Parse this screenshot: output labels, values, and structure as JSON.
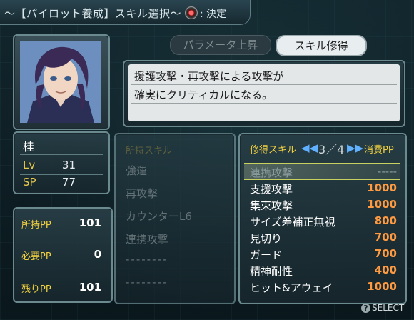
{
  "header": {
    "title": "〜【パイロット養成】スキル選択〜",
    "decide_label": ": 決定"
  },
  "pilot": {
    "name": "桂",
    "lv_label": "Lv",
    "lv": "31",
    "sp_label": "SP",
    "sp": "77"
  },
  "pp": {
    "owned_label": "所持PP",
    "owned": "101",
    "required_label": "必要PP",
    "required": "0",
    "remaining_label": "残りPP",
    "remaining": "101"
  },
  "tabs": {
    "param_label": "パラメータ上昇",
    "skill_label": "スキル修得"
  },
  "description": {
    "line1": "援護攻撃・再攻撃による攻撃が",
    "line2": "確実にクリティカルになる。"
  },
  "owned_skills": {
    "title": "所持スキル",
    "items": [
      "強運",
      "再攻撃",
      "カウンターL6",
      "連携攻撃",
      "--------",
      "--------"
    ]
  },
  "learn": {
    "title": "修得スキル",
    "page": "3／4",
    "cost_title": "消費PP",
    "items": [
      {
        "name": "連携攻撃",
        "cost": "-----",
        "selected": true
      },
      {
        "name": "支援攻撃",
        "cost": "1000"
      },
      {
        "name": "集束攻撃",
        "cost": "1000"
      },
      {
        "name": "サイズ差補正無視",
        "cost": "800"
      },
      {
        "name": "見切り",
        "cost": "700"
      },
      {
        "name": "ガード",
        "cost": "700"
      },
      {
        "name": "精神耐性",
        "cost": "400"
      },
      {
        "name": "ヒット&アウェイ",
        "cost": "1000"
      }
    ]
  },
  "footer": {
    "select_label": "SELECT"
  }
}
